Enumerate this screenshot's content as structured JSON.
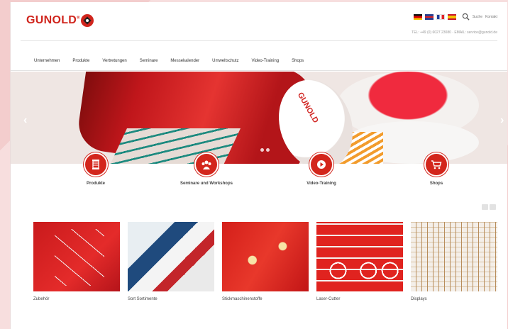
{
  "brand": {
    "name": "GUNOLD",
    "registered": "®"
  },
  "topbar": {
    "search_label": "Suche",
    "contact_label": "Kontakt",
    "contact_line": "TEL: +49 (0) 6027 23080 · EMAIL: service@gunold.de"
  },
  "nav": [
    "Unternehmen",
    "Produkte",
    "Vertretungen",
    "Seminare",
    "Messekalender",
    "Umweltschutz",
    "Video-Training",
    "Shops"
  ],
  "hero": {
    "spool_text": "GUNOLD",
    "prev_arrow": "‹",
    "next_arrow": "›"
  },
  "features": [
    {
      "label": "Produkte",
      "icon": "spool-icon"
    },
    {
      "label": "Seminare und Workshops",
      "icon": "people-icon"
    },
    {
      "label": "Video-Training",
      "icon": "play-icon"
    },
    {
      "label": "Shops",
      "icon": "cart-icon"
    }
  ],
  "products": [
    {
      "label": "Zubehör"
    },
    {
      "label": "Sort Sortimente"
    },
    {
      "label": "Stickmaschinenstoffe"
    },
    {
      "label": "Laser-Cutter"
    },
    {
      "label": "Displays"
    }
  ],
  "colors": {
    "brand": "#d0251d",
    "accent_background": "#f7dede"
  }
}
